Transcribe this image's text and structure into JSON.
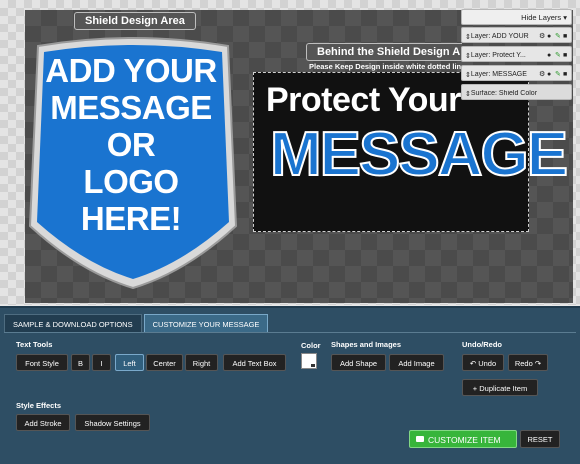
{
  "canvas": {
    "shield_area_label": "Shield Design Area",
    "behind_area_label": "Behind the Shield Design Area",
    "behind_note": "Please Keep Design inside white dotted line",
    "shield_text": [
      "ADD YOUR",
      "MESSAGE",
      "OR",
      "LOGO",
      "HERE!"
    ],
    "banner_line1": "Protect Your",
    "banner_line2": "MESSAGE",
    "shield_color": "#1a74d0"
  },
  "layers": {
    "toggle_label": "Hide Layers",
    "items": [
      {
        "label": "Layer: ADD YOUR"
      },
      {
        "label": "Layer: Protect Y..."
      },
      {
        "label": "Layer: MESSAGE"
      }
    ],
    "surface_label": "Surface: Shield Color"
  },
  "tabs": [
    {
      "label": "SAMPLE & DOWNLOAD OPTIONS"
    },
    {
      "label": "CUSTOMIZE YOUR MESSAGE"
    }
  ],
  "text_tools": {
    "label": "Text Tools",
    "font_style": "Font Style",
    "bold": "B",
    "italic": "I",
    "left": "Left",
    "center": "Center",
    "right": "Right",
    "add_text_box": "Add Text Box"
  },
  "color": {
    "label": "Color"
  },
  "shapes": {
    "label": "Shapes and Images",
    "add_shape": "Add Shape",
    "add_image": "Add Image"
  },
  "undo_redo": {
    "label": "Undo/Redo",
    "undo": "Undo",
    "redo": "Redo",
    "duplicate": "Duplicate Item"
  },
  "style_effects": {
    "label": "Style Effects",
    "add_stroke": "Add Stroke",
    "shadow": "Shadow Settings"
  },
  "actions": {
    "customize": "CUSTOMIZE ITEM",
    "reset": "RESET"
  }
}
